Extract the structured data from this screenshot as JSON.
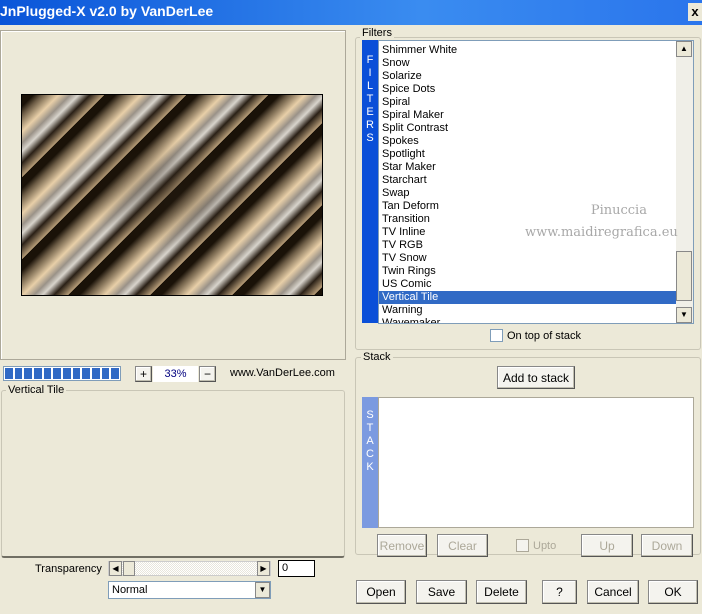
{
  "window": {
    "title": "JnPlugged-X v2.0 by VanDerLee",
    "close_label": "x"
  },
  "preview": {
    "progress_segments": 12,
    "zoom_in": "+",
    "zoom_out": "−",
    "zoom": "33%",
    "website": "www.VanDerLee.com"
  },
  "settings": {
    "group_label": "Vertical Tile",
    "transparency_label": "Transparency",
    "transparency_value": "0",
    "blend_mode": "Normal"
  },
  "filters": {
    "group_label": "Filters",
    "strip": "FILTERS",
    "items": [
      "Shimmer White",
      "Snow",
      "Solarize",
      "Spice Dots",
      "Spiral",
      "Spiral Maker",
      "Split Contrast",
      "Spokes",
      "Spotlight",
      "Star Maker",
      "Starchart",
      "Swap",
      "Tan Deform",
      "Transition",
      "TV Inline",
      "TV RGB",
      "TV Snow",
      "Twin Rings",
      "US Comic",
      "Vertical Tile",
      "Warning",
      "Wavemaker"
    ],
    "selected": "Vertical Tile",
    "on_top_label": "On top of stack",
    "watermark": [
      "Pinuccia",
      "www.maidiregrafica.eu"
    ]
  },
  "stack": {
    "group_label": "Stack",
    "add_label": "Add to stack",
    "strip": "STACK",
    "remove": "Remove",
    "clear": "Clear",
    "upto": "Upto",
    "up": "Up",
    "down": "Down"
  },
  "buttons": {
    "open": "Open",
    "save": "Save",
    "delete": "Delete",
    "help": "?",
    "cancel": "Cancel",
    "ok": "OK"
  },
  "colors": {
    "title": "#0a55d8",
    "selection": "#316ac5",
    "strip": "#0a4fd8",
    "stack_strip": "#7b9ae0"
  }
}
